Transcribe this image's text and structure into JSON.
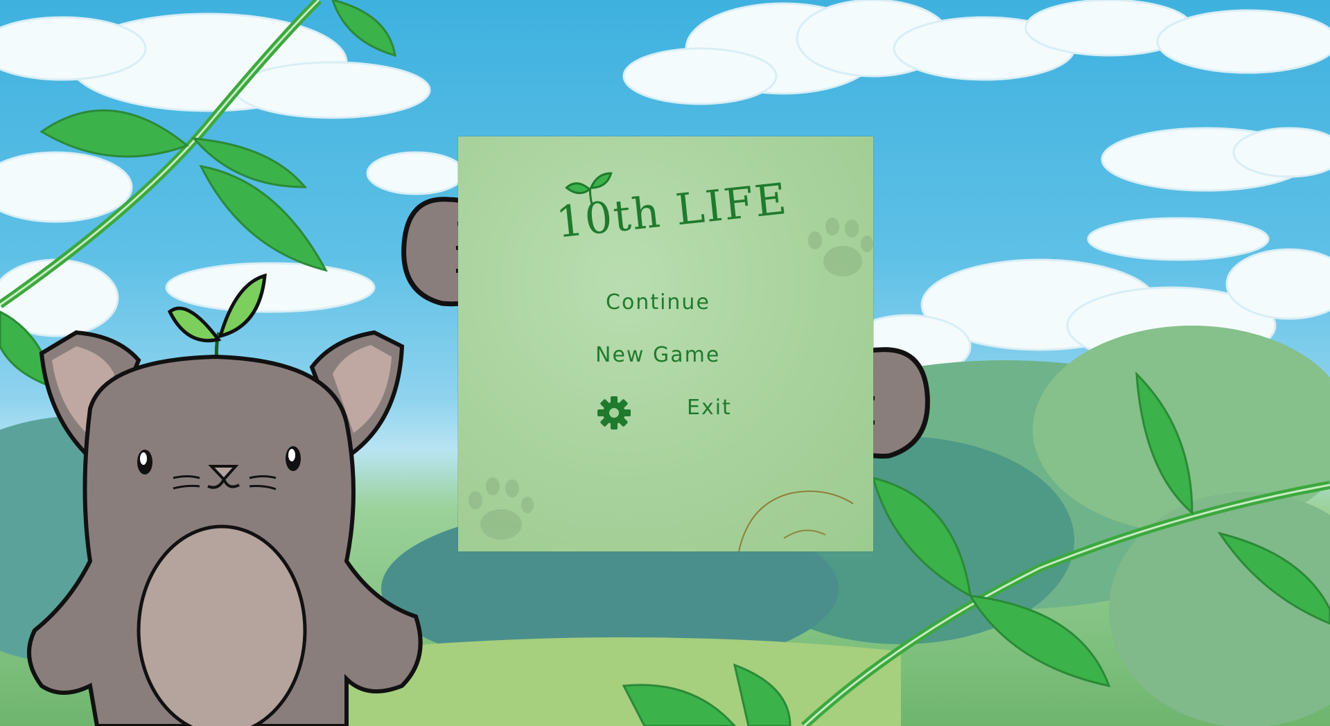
{
  "game": {
    "title": "10th LIFE"
  },
  "menu": {
    "continue_label": "Continue",
    "new_game_label": "New Game",
    "exit_label": "Exit"
  },
  "icons": {
    "settings": "gear-icon",
    "logo": "sprout-icon"
  },
  "colors": {
    "menu_text": "#1f7a2e",
    "board": "#a8d29c",
    "sky": "#3fb1df",
    "leaf": "#3ca83e",
    "cat_fur": "#8a7e7c"
  }
}
